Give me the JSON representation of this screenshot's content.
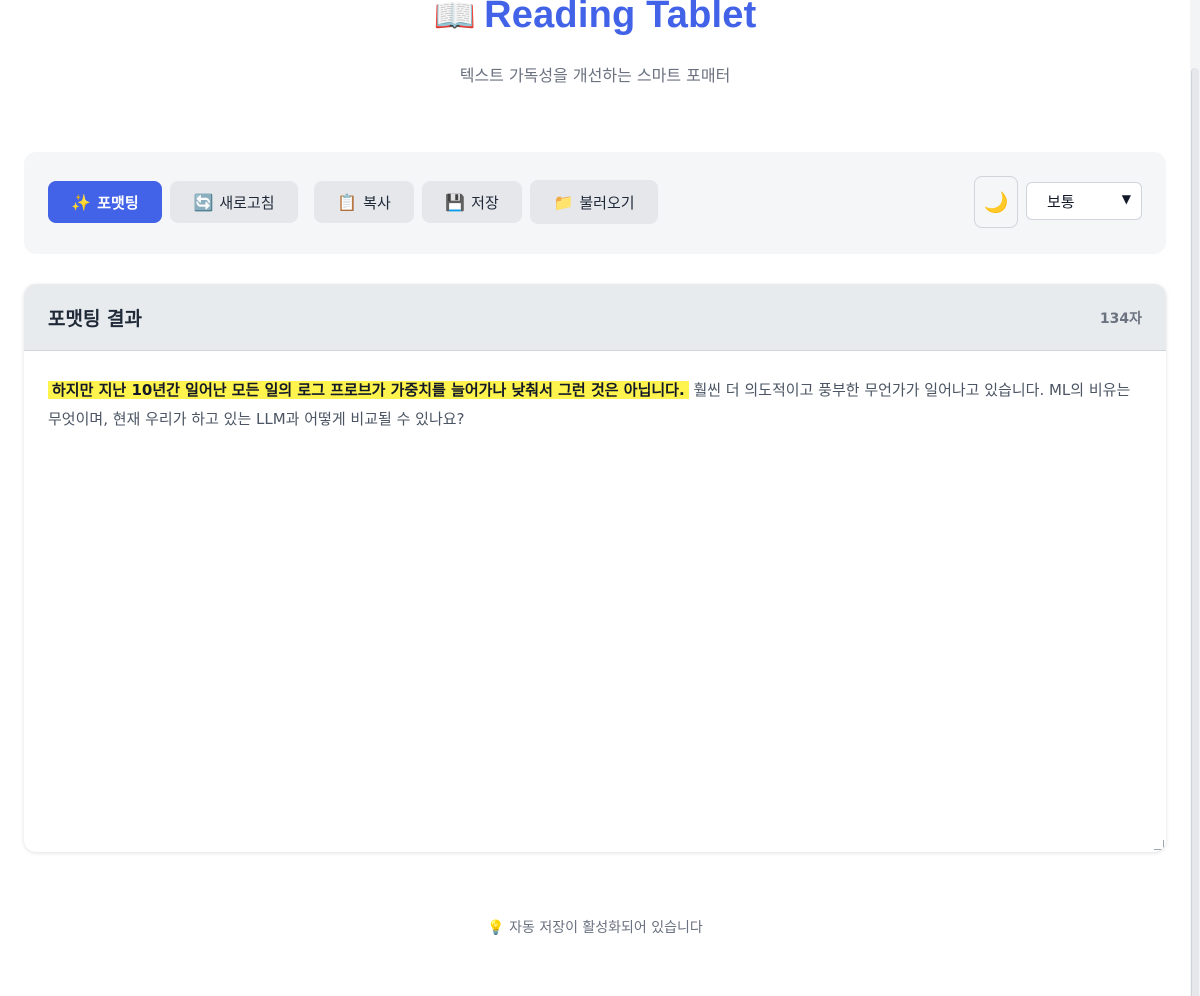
{
  "header": {
    "title_icon": "📖",
    "title": "Reading Tablet",
    "subtitle": "텍스트 가독성을 개선하는 스마트 포매터"
  },
  "toolbar": {
    "buttons": [
      {
        "icon": "✨",
        "label": "포맷팅",
        "name": "format"
      },
      {
        "icon": "🔄",
        "label": "새로고침",
        "name": "refresh"
      },
      {
        "icon": "📋",
        "label": "복사",
        "name": "copy"
      },
      {
        "icon": "💾",
        "label": "저장",
        "name": "save"
      },
      {
        "icon": "📁",
        "label": "불러오기",
        "name": "load"
      }
    ],
    "theme_icon": "🌙",
    "size_select": {
      "selected": "보통"
    }
  },
  "result": {
    "title": "포맷팅 결과",
    "char_count": "134자",
    "highlighted_text": "하지만 지난 10년간 일어난 모든 일의 로그 프로브가 가중치를 늘어가나 낮춰서 그런 것은 아닙니다.",
    "rest_text": " 훨씬 더 의도적이고 풍부한 무언가가 일어나고 있습니다. ML의 비유는 무엇이며, 현재 우리가 하고 있는 LLM과 어떻게 비교될 수 있나요?"
  },
  "footer": {
    "icon": "💡",
    "text": "자동 저장이 활성화되어 있습니다"
  },
  "colors": {
    "accent": "#4262e8",
    "highlight": "#fff34d"
  }
}
